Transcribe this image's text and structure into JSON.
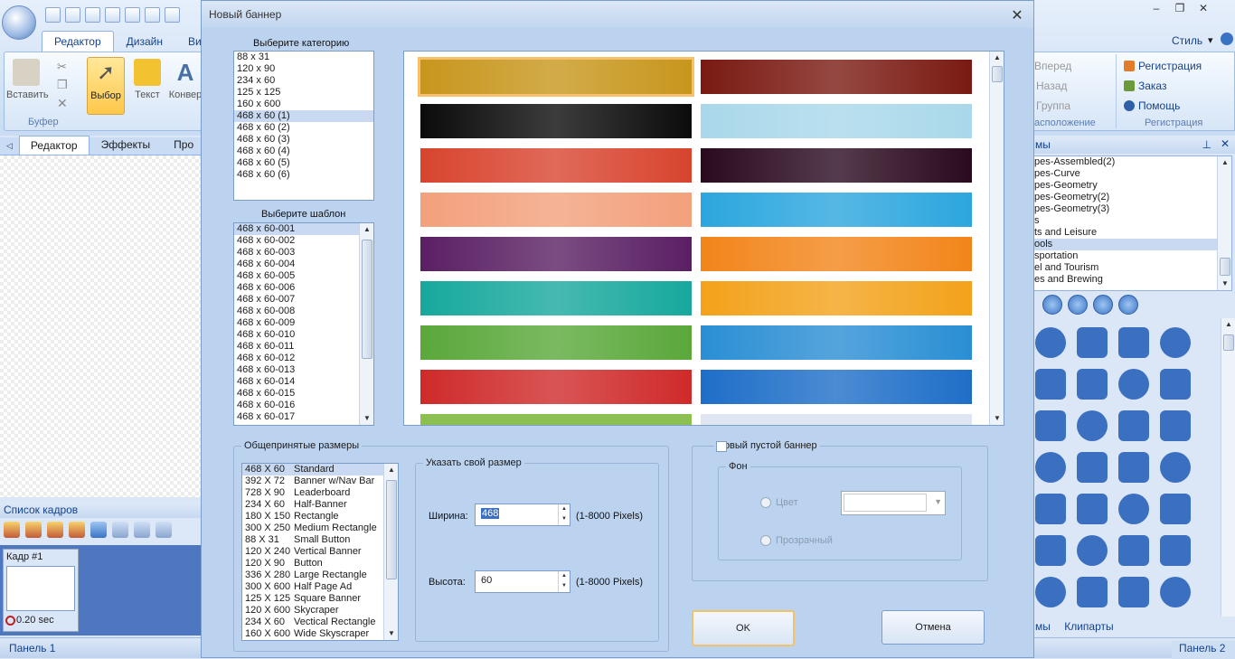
{
  "app": {
    "tabs": [
      "Редактор",
      "Дизайн",
      "Ви"
    ],
    "style_label": "Стиль",
    "ribbon": {
      "paste": "Вставить",
      "select": "Выбор",
      "text": "Текст",
      "convert": "Конвер",
      "group_label": "Буфер"
    },
    "right_ribbon": {
      "forward": "Вперед",
      "back": "Назад",
      "group": "Группа",
      "layout": "асположение",
      "register": "Регистрация",
      "order": "Заказ",
      "help": "Помощь",
      "reg_group": "Регистрация"
    },
    "left_tabs": [
      "Редактор",
      "Эффекты",
      "Про"
    ],
    "frames": {
      "title": "Список кадров",
      "frame_label": "Кадр #1",
      "frame_time": "0.20 sec"
    },
    "right_panel": {
      "title": "мы",
      "items": [
        "pes-Assembled(2)",
        "pes-Curve",
        "pes-Geometry",
        "pes-Geometry(2)",
        "pes-Geometry(3)",
        "s",
        "ts and Leisure",
        "ools",
        "sportation",
        "el and Tourism",
        "es and Brewing"
      ],
      "selected_index": 7,
      "bottom_tabs": [
        "мы",
        "Клипарты"
      ]
    },
    "status": {
      "left": "Панель 1",
      "right": "Панель 2"
    }
  },
  "dialog": {
    "title": "Новый баннер",
    "category_label": "Выберите категорию",
    "categories": [
      "88 x 31",
      "120 x 90",
      "234 x 60",
      "125 x 125",
      "160 x 600",
      "468 x 60 (1)",
      "468 x 60 (2)",
      "468 x 60 (3)",
      "468 x 60 (4)",
      "468 x 60 (5)",
      "468 x 60 (6)"
    ],
    "category_selected": 5,
    "template_label": "Выберите шаблон",
    "templates": [
      "468 x 60-001",
      "468 x 60-002",
      "468 x 60-003",
      "468 x 60-004",
      "468 x 60-005",
      "468 x 60-006",
      "468 x 60-007",
      "468 x 60-008",
      "468 x 60-009",
      "468 x 60-010",
      "468 x 60-011",
      "468 x 60-012",
      "468 x 60-013",
      "468 x 60-014",
      "468 x 60-015",
      "468 x 60-016",
      "468 x 60-017"
    ],
    "template_selected": 0,
    "common_sizes_label": "Общепринятые размеры",
    "common_sizes": [
      [
        "468 X 60",
        "Standard"
      ],
      [
        "392 X 72",
        "Banner w/Nav Bar"
      ],
      [
        "728 X 90",
        "Leaderboard"
      ],
      [
        "234 X 60",
        "Half-Banner"
      ],
      [
        "180 X 150",
        "Rectangle"
      ],
      [
        "300 X 250",
        "Medium Rectangle"
      ],
      [
        "88 X 31",
        "Small Button"
      ],
      [
        "120 X 240",
        "Vertical Banner"
      ],
      [
        "120 X 90",
        "Button"
      ],
      [
        "336 X 280",
        "Large Rectangle"
      ],
      [
        "300 X 600",
        "Half Page Ad"
      ],
      [
        "125 X 125",
        "Square Banner"
      ],
      [
        "120 X 600",
        "Skycraper"
      ],
      [
        "234 X 60",
        "Vectical Rectangle"
      ],
      [
        "160 X 600",
        "Wide Skyscraper"
      ]
    ],
    "custom_size_label": "Указать свой размер",
    "width_label": "Ширина:",
    "width_value": "468",
    "height_label": "Высота:",
    "height_value": "60",
    "range_hint": "(1-8000 Pixels)",
    "blank_banner_label": "Новый пустой баннер",
    "background_label": "Фон",
    "color_label": "Цвет",
    "transparent_label": "Прозрачный",
    "ok": "OK",
    "cancel": "Отмена",
    "gallery_colors": [
      [
        "#c7961c",
        "#7a1a12"
      ],
      [
        "#0b0b0b",
        "#a9d8ea"
      ],
      [
        "#d8442e",
        "#2a0a1e"
      ],
      [
        "#f3a07c",
        "#2ba6de"
      ],
      [
        "#5a1f63",
        "#f2851a"
      ],
      [
        "#17a89d",
        "#f3a21a"
      ],
      [
        "#5aa83a",
        "#2a8ed4"
      ],
      [
        "#cf2a2a",
        "#1e6ec8"
      ]
    ]
  }
}
